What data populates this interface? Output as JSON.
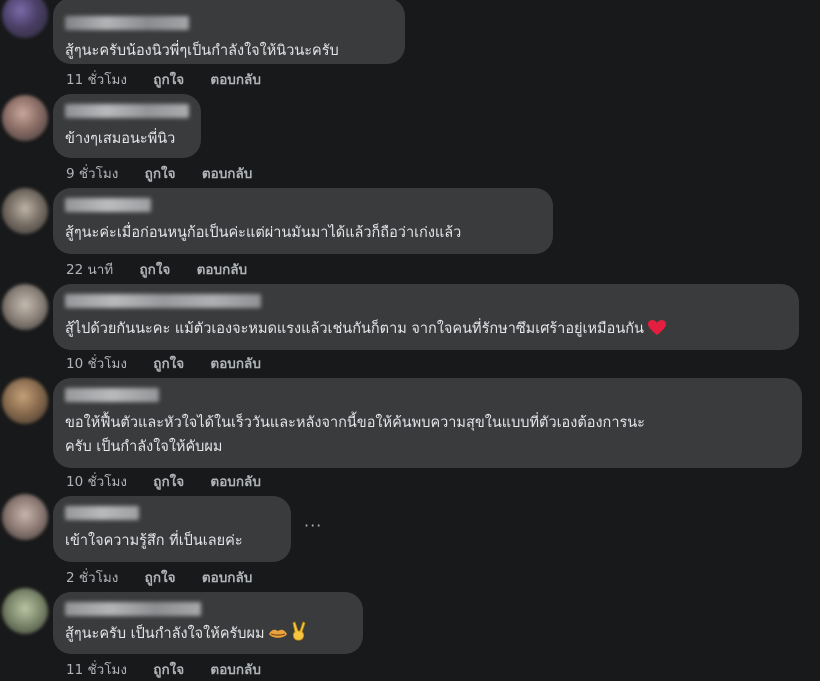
{
  "comments": [
    {
      "text": "สู้ๆนะครับน้องนิวพี่ๆเป็นกำลังใจให้นิวนะครับ",
      "time": "11 ชั่วโมง",
      "like": "ถูกใจ",
      "reply": "ตอบกลับ"
    },
    {
      "text": "ข้างๆเสมอนะพี่นิว",
      "time": "9 ชั่วโมง",
      "like": "ถูกใจ",
      "reply": "ตอบกลับ"
    },
    {
      "text": "สู้ๆนะค่ะเมื่อก่อนหนูก้อเป็นค่ะแต่ผ่านมันมาได้แล้วก็ถือว่าเก่งแล้ว",
      "time": "22 นาที",
      "like": "ถูกใจ",
      "reply": "ตอบกลับ"
    },
    {
      "text": "สู้ไปด้วยกันนะคะ แม้ตัวเองจะหมดแรงแล้วเช่นกันก็ตาม จากใจคนที่รักษาซึมเศร้าอยู่เหมือนกัน",
      "time": "10 ชั่วโมง",
      "like": "ถูกใจ",
      "reply": "ตอบกลับ"
    },
    {
      "text_line1": "ขอให้ฟื้นตัวและหัวใจได้ในเร็ววันและหลังจากนี้ขอให้ค้นพบความสุขในแบบที่ตัวเองต้องการนะ",
      "text_line2": "ครับ เป็นกำลังใจให้คับผม",
      "time": "10 ชั่วโมง",
      "like": "ถูกใจ",
      "reply": "ตอบกลับ"
    },
    {
      "text": "เข้าใจความรู้สึก ที่เป็นเลยค่ะ",
      "time": "2 ชั่วโมง",
      "like": "ถูกใจ",
      "reply": "ตอบกลับ",
      "more": "···"
    },
    {
      "text": "สู้ๆนะครับ เป็นกำลังใจให้ครับผม",
      "time": "11 ชั่วโมง",
      "like": "ถูกใจ",
      "reply": "ตอบกลับ"
    }
  ],
  "colors": {
    "background": "#18191a",
    "bubble": "#3a3b3c",
    "text": "#e4e6eb",
    "meta": "#b0b3b8",
    "heart": "#e41e3f"
  },
  "icons": [
    "heart-emoji-icon",
    "lips-emoji-icon",
    "victory-hand-emoji-icon",
    "more-options-icon"
  ]
}
